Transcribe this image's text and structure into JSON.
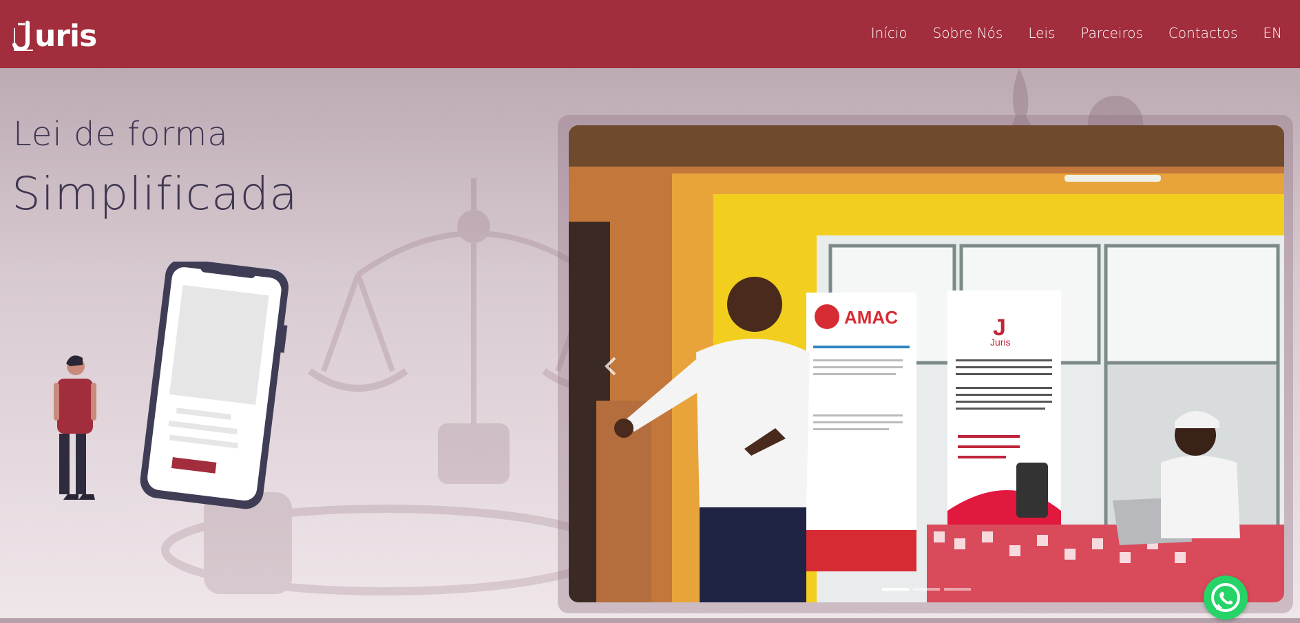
{
  "brand": {
    "logo_text": "uris",
    "logo_icon": "juris-j-icon"
  },
  "nav": {
    "items": [
      {
        "label": "Início"
      },
      {
        "label": "Sobre Nós"
      },
      {
        "label": "Leis"
      },
      {
        "label": "Parceiros"
      },
      {
        "label": "Contactos"
      },
      {
        "label": "EN"
      }
    ]
  },
  "hero": {
    "line1": "Lei de forma",
    "line2": "Simplificada"
  },
  "carousel": {
    "slide_count": 3,
    "active_index": 0,
    "prev_icon": "chevron-left-icon"
  },
  "whatsapp": {
    "icon": "whatsapp-icon"
  },
  "colors": {
    "brand": "#a22d3c",
    "text": "#3f3651",
    "whatsapp": "#25d366"
  }
}
